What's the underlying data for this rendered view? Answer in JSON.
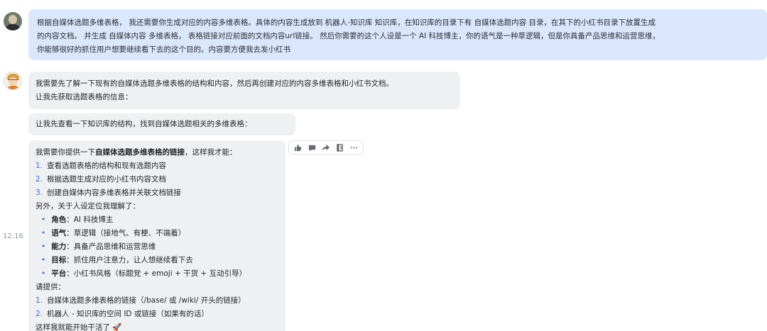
{
  "user_message": {
    "lines": [
      "根据自媒体选题多维表格， 我还需要你生成对应的内容多维表格。具体的内容生成放到 机器人-知识库 知识库，在知识库的目录下有 自媒体选题内容 目录，在其下的小红书目录下放置生成",
      "的内容文档。 并生成 自媒体内容 多维表格， 表格链接对应前面的文档内容url链接。 然后你需要的这个人设是一个 AI 科技博主，你的语气是一种草逻辑，但是你具备产品思维和运营思维，",
      "你能够很好的抓住用户想要继续看下去的这个目的。内容要方便我去发小红书"
    ]
  },
  "bot_messages": {
    "msg1": {
      "line1": "我需要先了解一下现有的自媒体选题多维表格的结构和内容，然后再创建对应的内容多维表格和小红书文档。",
      "line2": "让我先获取选题表格的信息："
    },
    "msg2": {
      "line1": "让我先查看一下知识库的结构，找到自媒体选题相关的多维表格："
    },
    "msg3": {
      "intro_prefix": "我需要你提供一下",
      "intro_bold": "自媒体选题多维表格的链接",
      "intro_suffix": "，这样我才能：",
      "abilities": [
        {
          "num": "1.",
          "text": "查看选题表格的结构和现有选题内容"
        },
        {
          "num": "2.",
          "text": "根据选题生成对应的小红书内容文档"
        },
        {
          "num": "3.",
          "text": "创建自媒体内容多维表格并关联文档链接"
        }
      ],
      "persona_intro": "另外，关于人设定位我理解了：",
      "persona": [
        {
          "label": "角色",
          "text": "：AI 科技博主"
        },
        {
          "label": "语气",
          "text": "：草逻辑（接地气、有梗、不端着）"
        },
        {
          "label": "能力",
          "text": "：具备产品思维和运营思维"
        },
        {
          "label": "目标",
          "text": "：抓住用户注意力，让人想继续看下去"
        },
        {
          "label": "平台",
          "text": "：小红书风格（标题党 + emoji + 干货 + 互动引导）"
        }
      ],
      "request_intro": "请提供：",
      "requests": [
        {
          "num": "1.",
          "text": "自媒体选题多维表格的链接（/base/ 或 /wiki/ 开头的链接）"
        },
        {
          "num": "2.",
          "text": "机器人 - 知识库的空间 ID 或链接（如果有的话）"
        }
      ],
      "closing": "这样我就能开始干活了 🚀"
    }
  },
  "timestamp": "12:16",
  "toolbar_icons": [
    "thumbs-up-icon",
    "comment-icon",
    "forward-icon",
    "pin-icon",
    "more-icon"
  ],
  "colors": {
    "user_bubble": "#dbe7fd",
    "bot_bubble": "#eff0f1",
    "accent": "#3370ff"
  }
}
